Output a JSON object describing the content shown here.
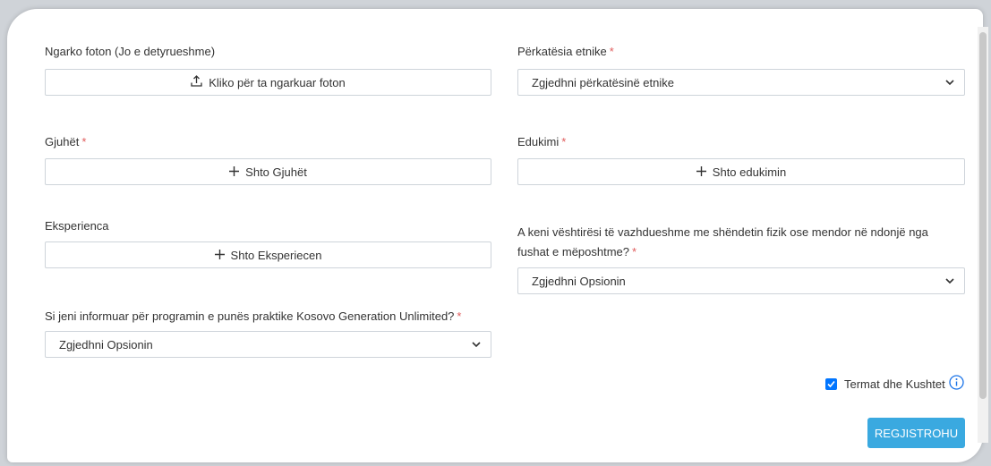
{
  "form": {
    "photo": {
      "label": "Ngarko foton (Jo e detyrueshme)",
      "button": "Kliko për ta ngarkuar foton",
      "icon": "upload-icon"
    },
    "ethnicity": {
      "label": "Përkatësia etnike",
      "required": "*",
      "value": "Zgjedhni përkatësinë etnike"
    },
    "languages": {
      "label": "Gjuhët",
      "required": "*",
      "button": "Shto Gjuhët",
      "icon": "plus-icon"
    },
    "education": {
      "label": "Edukimi",
      "required": "*",
      "button": "Shto edukimin",
      "icon": "plus-icon"
    },
    "experience": {
      "label": "Eksperienca",
      "button": "Shto Eksperiecen",
      "icon": "plus-icon"
    },
    "health": {
      "label": "A keni vështirësi të vazhdueshme me shëndetin fizik ose mendor në ndonjë nga fushat e mëposhtme?",
      "required": "*",
      "value": "Zgjedhni Opsionin"
    },
    "informed": {
      "label": "Si jeni informuar për programin e punës praktike Kosovo Generation Unlimited?",
      "required": "*",
      "value": "Zgjedhni Opsionin"
    },
    "terms": {
      "label": "Termat dhe Kushtet",
      "checked": true,
      "icon": "info-icon"
    },
    "submit": {
      "label": "REGJISTROHU"
    }
  },
  "colors": {
    "accent": "#3aa9e0",
    "required": "#e05c5c",
    "checkbox": "#0075ff",
    "info": "#1a73e8"
  }
}
